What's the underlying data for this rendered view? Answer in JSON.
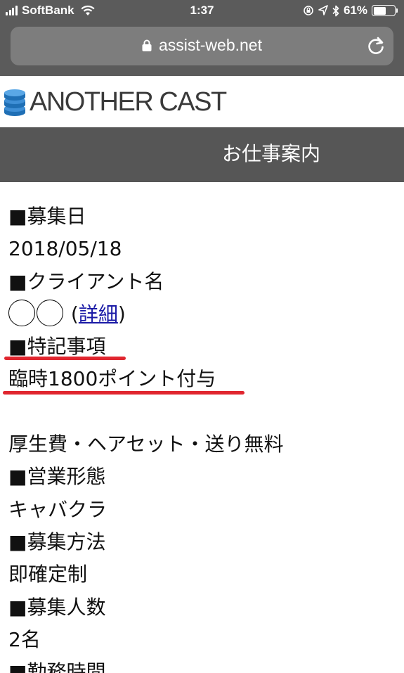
{
  "status_bar": {
    "carrier": "SoftBank",
    "time": "1:37",
    "battery_percent": "61%",
    "battery_level": 0.61
  },
  "browser": {
    "url": "assist-web.net"
  },
  "site": {
    "logo": "ANOTHER CAST",
    "nav_title": "お仕事案内"
  },
  "content": {
    "recruit_date_label": "■募集日",
    "recruit_date": "2018/05/18",
    "client_label": "■クライアント名",
    "client_open_paren": "(",
    "client_detail_link": "詳細",
    "client_close_paren": ")",
    "notes_label": "■特記事項",
    "notes_line1": "臨時1800ポイント付与",
    "notes_line2": "厚生費・ヘアセット・送り無料",
    "business_label": "■営業形態",
    "business_value": "キャバクラ",
    "method_label": "■募集方法",
    "method_value": "即確定制",
    "count_label": "■募集人数",
    "count_value": "2名",
    "hours_label": "■勤務時間"
  },
  "colors": {
    "chrome": "#5b5b5b",
    "nav": "#565656",
    "link": "#1a1aa6",
    "highlight": "#e0262f"
  }
}
